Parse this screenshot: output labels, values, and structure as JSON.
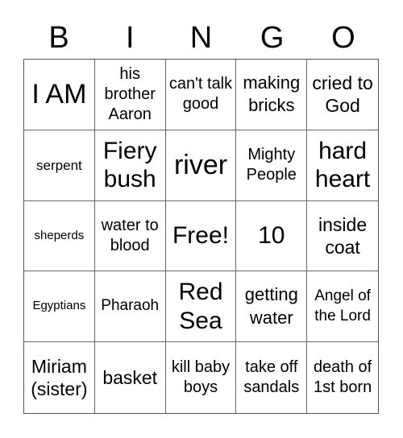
{
  "header": {
    "letters": [
      "B",
      "I",
      "N",
      "G",
      "O"
    ]
  },
  "grid": {
    "cells": [
      [
        "I AM",
        "his brother Aaron",
        "can't talk good",
        "making bricks",
        "cried to God"
      ],
      [
        "serpent",
        "Fiery bush",
        "river",
        "Mighty People",
        "hard heart"
      ],
      [
        "sheperds",
        "water to blood",
        "Free!",
        "10",
        "inside coat"
      ],
      [
        "Egyptians",
        "Pharaoh",
        "Red Sea",
        "getting water",
        "Angel of the Lord"
      ],
      [
        "Miriam (sister)",
        "basket",
        "kill baby boys",
        "take off sandals",
        "death of 1st born"
      ]
    ]
  },
  "colors": {
    "grid_line": "#666666",
    "text": "#000000",
    "background": "#ffffff"
  }
}
